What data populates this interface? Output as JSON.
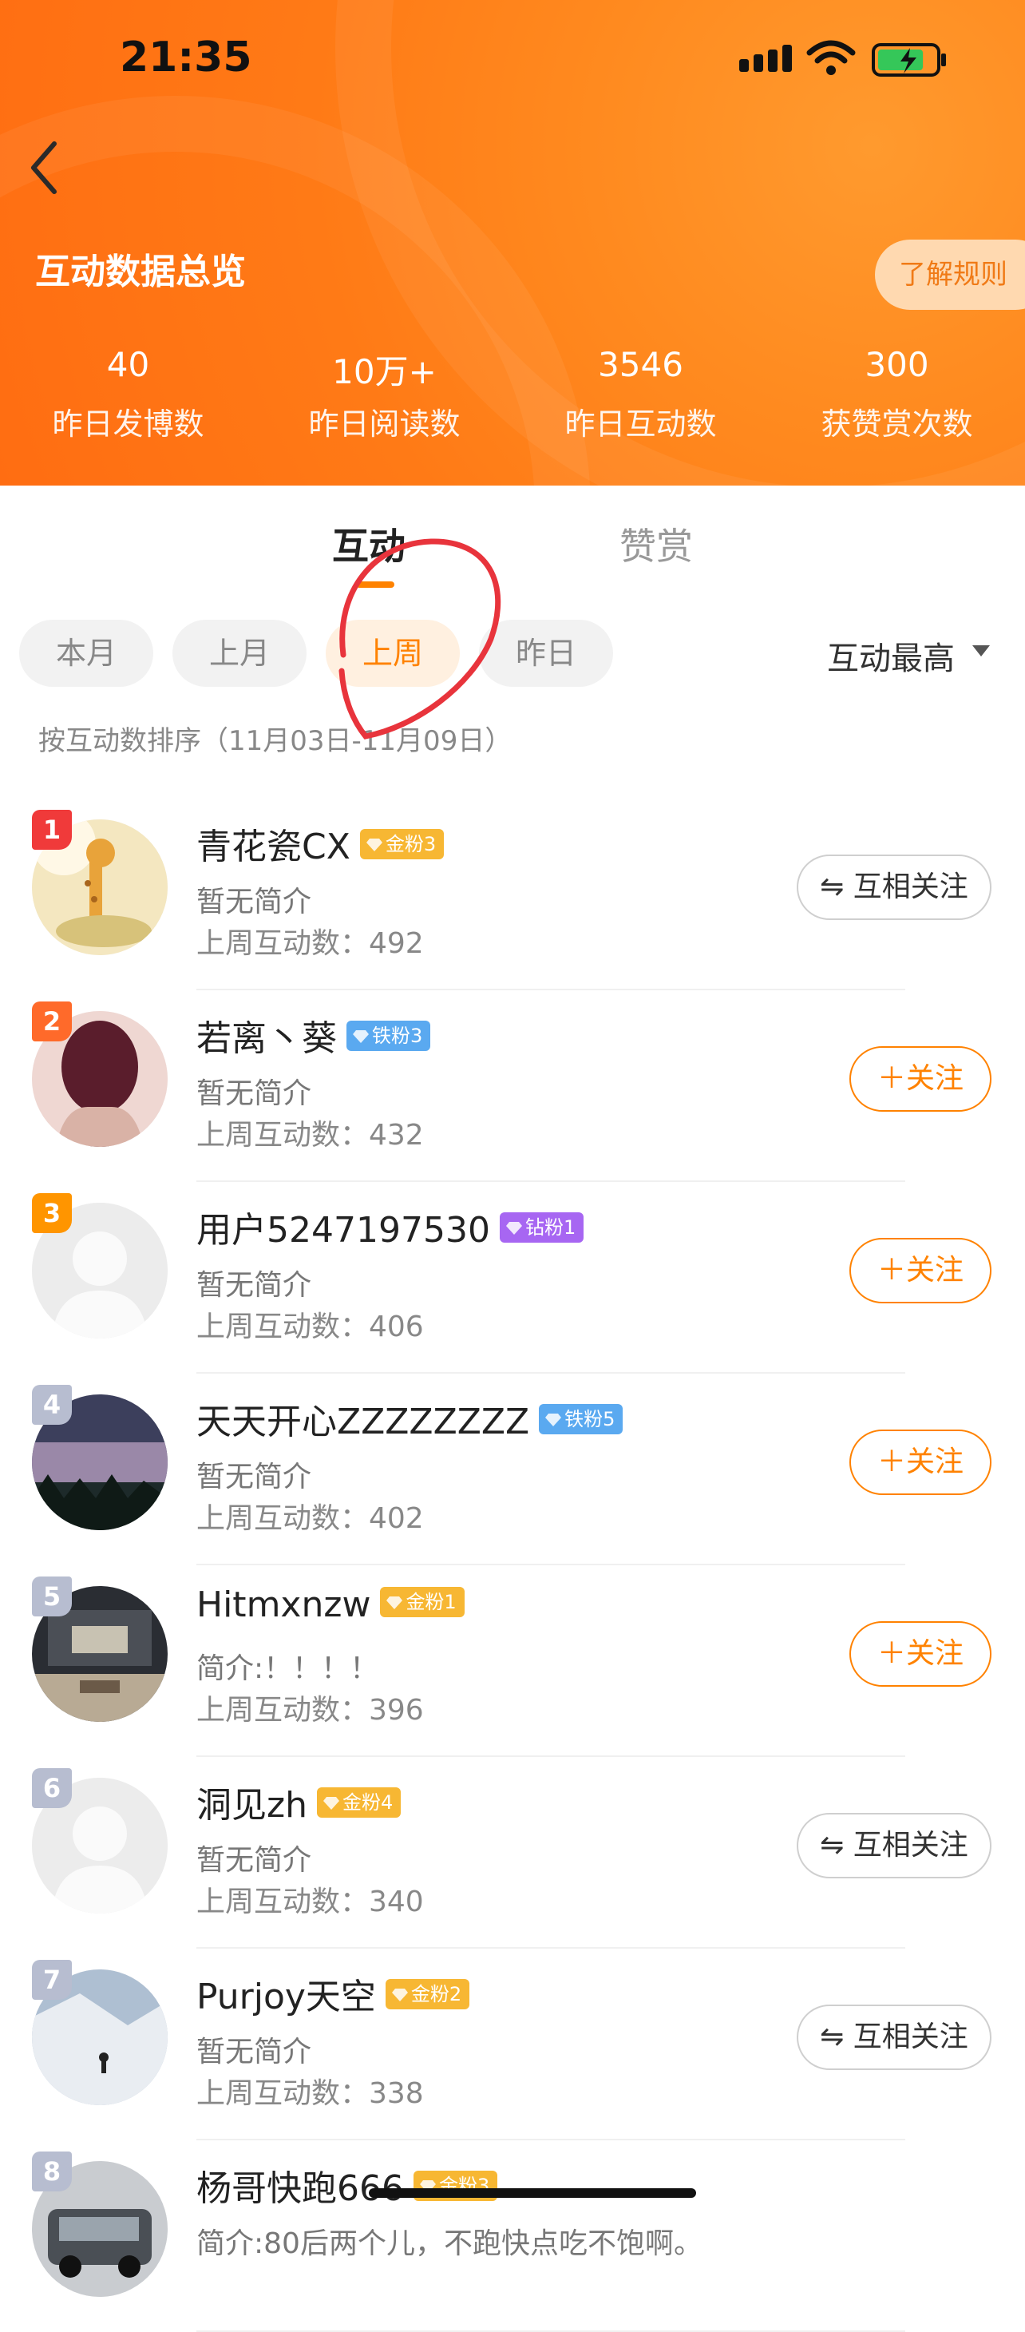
{
  "status_bar": {
    "time": "21:35"
  },
  "header": {
    "title": "互动数据总览",
    "rules_label": "了解规则",
    "stats": [
      {
        "value": "40",
        "label": "昨日发博数"
      },
      {
        "value": "10万+",
        "label": "昨日阅读数"
      },
      {
        "value": "3546",
        "label": "昨日互动数"
      },
      {
        "value": "300",
        "label": "获赞赏次数"
      }
    ]
  },
  "tabs": [
    {
      "label": "互动",
      "active": true
    },
    {
      "label": "赞赏",
      "active": false
    }
  ],
  "filters": [
    {
      "label": "本月",
      "active": false
    },
    {
      "label": "上月",
      "active": false
    },
    {
      "label": "上周",
      "active": true
    },
    {
      "label": "昨日",
      "active": false
    }
  ],
  "sort": {
    "label": "互动最高"
  },
  "sort_caption": "按互动数排序（11月03日-11月09日）",
  "colors": {
    "accent": "#ff8200",
    "header": "#ff7a16",
    "annotation": "#e8343c"
  },
  "list": [
    {
      "rank": "1",
      "rank_color": "#f03a3a",
      "name": "青花瓷CX",
      "badge": "金粉3",
      "badge_type": "gold",
      "bio": "暂无简介",
      "count": "上周互动数：492",
      "action": "⇋ 互相关注",
      "action_type": "mutual",
      "avatar": "giraffe"
    },
    {
      "rank": "2",
      "rank_color": "#ff6a2a",
      "name": "若离丶葵",
      "badge": "铁粉3",
      "badge_type": "iron",
      "bio": "暂无简介",
      "count": "上周互动数：432",
      "action": "＋关注",
      "action_type": "follow",
      "avatar": "hair"
    },
    {
      "rank": "3",
      "rank_color": "#ff9500",
      "name": "用户5247197530",
      "badge": "钻粉1",
      "badge_type": "diamond",
      "bio": "暂无简介",
      "count": "上周互动数：406",
      "action": "＋关注",
      "action_type": "follow",
      "avatar": "default"
    },
    {
      "rank": "4",
      "rank_color": "#b7bdd0",
      "name": "天天开心ZZZZZZZZ",
      "badge": "铁粉5",
      "badge_type": "iron",
      "bio": "暂无简介",
      "count": "上周互动数：402",
      "action": "＋关注",
      "action_type": "follow",
      "avatar": "night"
    },
    {
      "rank": "5",
      "rank_color": "#b7bdd0",
      "name": "Hitmxnzw",
      "badge": "金粉1",
      "badge_type": "gold",
      "bio": "简介:！！！！",
      "count": "上周互动数：396",
      "action": "＋关注",
      "action_type": "follow",
      "avatar": "room"
    },
    {
      "rank": "6",
      "rank_color": "#b7bdd0",
      "name": "洞见zh",
      "badge": "金粉4",
      "badge_type": "gold",
      "bio": "暂无简介",
      "count": "上周互动数：340",
      "action": "⇋ 互相关注",
      "action_type": "mutual",
      "avatar": "default"
    },
    {
      "rank": "7",
      "rank_color": "#b7bdd0",
      "name": "Purjoy天空",
      "badge": "金粉2",
      "badge_type": "gold",
      "bio": "暂无简介",
      "count": "上周互动数：338",
      "action": "⇋ 互相关注",
      "action_type": "mutual",
      "avatar": "snow"
    },
    {
      "rank": "8",
      "rank_color": "#b7bdd0",
      "name": "杨哥快跑666",
      "badge": "金粉3",
      "badge_type": "gold",
      "bio": "简介:80后两个儿，不跑快点吃不饱啊。",
      "count": "",
      "action": "",
      "action_type": "follow",
      "avatar": "car"
    }
  ]
}
